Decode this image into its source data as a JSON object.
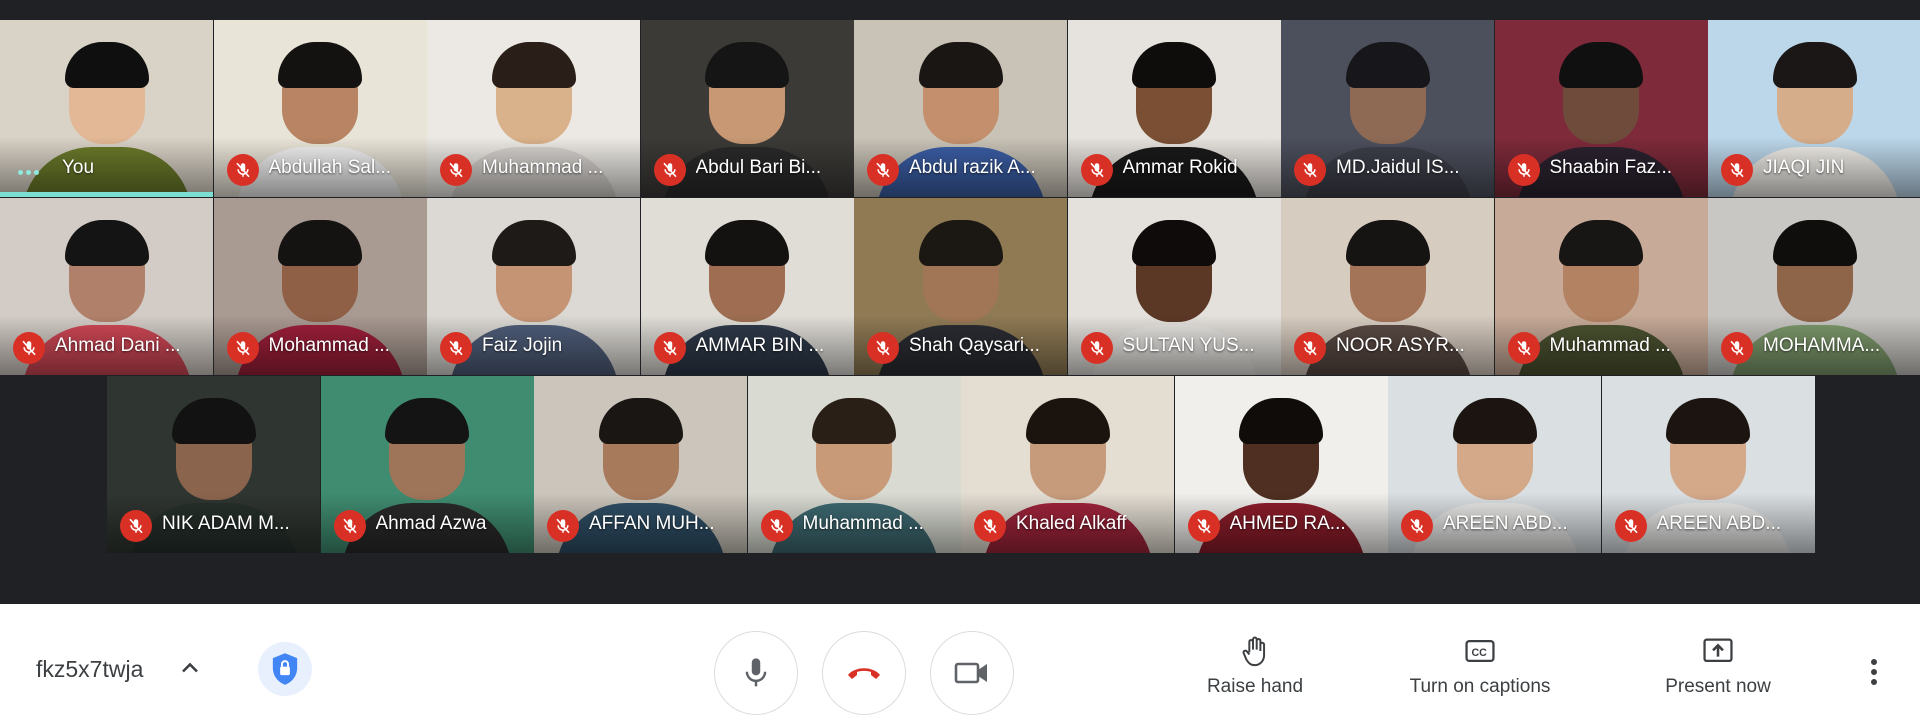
{
  "participants": {
    "row1": [
      {
        "name": "You",
        "self": true,
        "bg": "#d9d2c6",
        "shirt": "#6b7a2a",
        "skin": "#e2b896",
        "hair": "#0f0f0f"
      },
      {
        "name": "Abdullah Sal...",
        "bg": "#e9e4d8",
        "shirt": "#f1f1f1",
        "skin": "#b88463",
        "hair": "#141210"
      },
      {
        "name": "Muhammad ...",
        "bg": "#ece9e4",
        "shirt": "#d7d3cf",
        "skin": "#d9b18a",
        "hair": "#2a1f18"
      },
      {
        "name": "Abdul Bari Bi...",
        "bg": "#3b3a37",
        "shirt": "#2a2a2a",
        "skin": "#c79873",
        "hair": "#151515"
      },
      {
        "name": "Abdul razik A...",
        "bg": "#c9c3b7",
        "shirt": "#3b5ea6",
        "skin": "#c38f6c",
        "hair": "#1a1614"
      },
      {
        "name": "Ammar Rokid",
        "bg": "#e6e2dd",
        "shirt": "#1a1a1a",
        "skin": "#7a4f34",
        "hair": "#0f0d0c"
      },
      {
        "name": "MD.Jaidul IS...",
        "bg": "#4c4f5c",
        "shirt": "#3d3f4a",
        "skin": "#8e6a55",
        "hair": "#17161a"
      },
      {
        "name": "Shaabin Faz...",
        "bg": "#7e2a3a",
        "shirt": "#2b2330",
        "skin": "#6e4b3a",
        "hair": "#101010"
      },
      {
        "name": "JIAQI JIN",
        "bg": "#bcd7ea",
        "shirt": "#f0ede8",
        "skin": "#d6ad8a",
        "hair": "#1a1716"
      }
    ],
    "row2": [
      {
        "name": "Ahmad Dani ...",
        "bg": "#d3ccc6",
        "shirt": "#d14856",
        "skin": "#b0806a",
        "hair": "#141414"
      },
      {
        "name": "Mohammad ...",
        "bg": "#a99a92",
        "shirt": "#9f1f3a",
        "skin": "#8f5f46",
        "hair": "#151312"
      },
      {
        "name": "Faiz Jojin",
        "bg": "#dcd9d4",
        "shirt": "#4f5e7a",
        "skin": "#c49474",
        "hair": "#1d1a17"
      },
      {
        "name": "AMMAR BIN ...",
        "bg": "#e0ddd7",
        "shirt": "#2f3a4a",
        "skin": "#9e6d52",
        "hair": "#141210"
      },
      {
        "name": "Shah Qaysari...",
        "bg": "#8f7a54",
        "shirt": "#2b2d33",
        "skin": "#a07656",
        "hair": "#1b1813"
      },
      {
        "name": "SULTAN YUS...",
        "bg": "#e4e1dc",
        "shirt": "#e8e6e2",
        "skin": "#5b3726",
        "hair": "#0e0b0a"
      },
      {
        "name": "NOOR ASYR...",
        "bg": "#d7ccc0",
        "shirt": "#5a4a44",
        "skin": "#a47458",
        "hair": "#161412"
      },
      {
        "name": "Muhammad ...",
        "bg": "#c7aa98",
        "shirt": "#4b5230",
        "skin": "#b28262",
        "hair": "#181614"
      },
      {
        "name": "MOHAMMA...",
        "bg": "#c9c7c3",
        "shirt": "#7e9a6c",
        "skin": "#8f6549",
        "hair": "#0f0e0d"
      }
    ],
    "row3": [
      {
        "name": "NIK ADAM M...",
        "bg": "#2f3530",
        "shirt": "#26302b",
        "skin": "#8b644d",
        "hair": "#121212"
      },
      {
        "name": "Ahmad Azwa",
        "bg": "#3f8c70",
        "shirt": "#2a2a2a",
        "skin": "#9f7559",
        "hair": "#141414"
      },
      {
        "name": "AFFAN MUH...",
        "bg": "#cbc5bb",
        "shirt": "#2f4f66",
        "skin": "#a87a5c",
        "hair": "#1a1614"
      },
      {
        "name": "Muhammad ...",
        "bg": "#d9dbd3",
        "shirt": "#3e6a72",
        "skin": "#c99a78",
        "hair": "#2a1f16"
      },
      {
        "name": "Khaled Alkaff",
        "bg": "#e3ddd2",
        "shirt": "#a1243b",
        "skin": "#c69b7c",
        "hair": "#1b130e"
      },
      {
        "name": "AHMED RA...",
        "bg": "#f1efec",
        "shirt": "#8d1d2a",
        "skin": "#4e2f22",
        "hair": "#0f0c0a"
      },
      {
        "name": "AREEN ABD...",
        "bg": "#dadfe2",
        "shirt": "#e9e9e8",
        "skin": "#d4a98a",
        "hair": "#1c1410"
      },
      {
        "name": "AREEN ABD...",
        "bg": "#dadfe2",
        "shirt": "#e9e9e8",
        "skin": "#d4a98a",
        "hair": "#1c1410"
      }
    ]
  },
  "bottom_bar": {
    "meeting_code": "fkz5x7twja",
    "raise_hand_label": "Raise hand",
    "captions_label": "Turn on captions",
    "present_label": "Present now"
  },
  "colors": {
    "mute_red": "#d93025",
    "hangup_red": "#d93025",
    "shield_blue": "#1a73e8",
    "speaking": "#7cdfd2"
  }
}
